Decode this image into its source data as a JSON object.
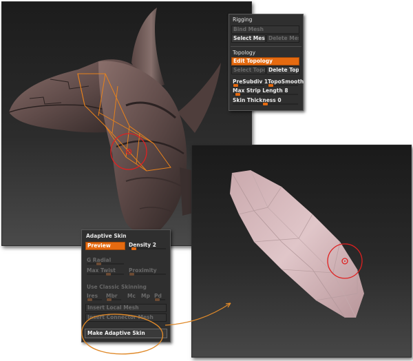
{
  "topology_panel": {
    "rigging_header": "Rigging",
    "bind_mesh": "Bind Mesh",
    "select_mesh": "Select Mesh",
    "delete_mesh": "Delete Mesh",
    "topology_header": "Topology",
    "edit_topology": "Edit Topology",
    "select_topo": "Select Topo",
    "delete_topo": "Delete Topo",
    "presubdiv": "PreSubdiv 1",
    "toposmooth": "TopoSmooth",
    "max_strip_length": "Max Strip Length 8",
    "skin_thickness": "Skin Thickness 0"
  },
  "adaptive_panel": {
    "title": "Adaptive Skin",
    "preview": "Preview",
    "density": "Density 2",
    "g_radial": "G Radial",
    "max_twist": "Max Twist",
    "proximity": "Proximity",
    "use_classic": "Use Classic Skinning",
    "ires": "Ires",
    "mbr": "Mbr",
    "mc": "Mc",
    "mp": "Mp",
    "pd": "Pd",
    "insert_local_mesh": "Insert Local Mesh",
    "insert_connector_mesh": "Insert Connector Mesh",
    "make_adaptive_skin": "Make Adaptive Skin"
  },
  "colors": {
    "accent_orange": "#e56a10",
    "annotation_orange": "#e08a2a",
    "cursor_red": "#e02020",
    "model_brown": "#6b5452",
    "skin_pink": "#d8bcc0"
  },
  "icons": {
    "brush_cursor": "brush-circle-icon",
    "arrow": "curved-arrow-icon"
  }
}
